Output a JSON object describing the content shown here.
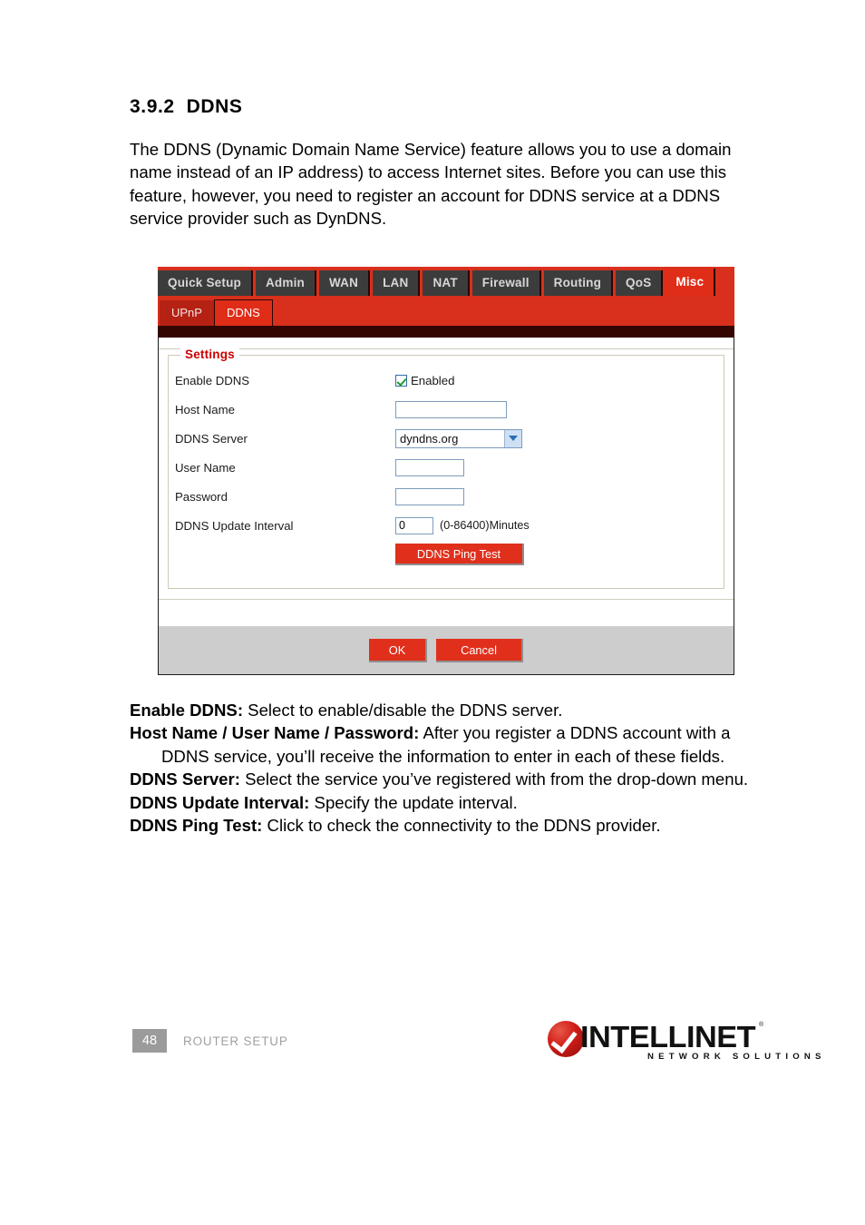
{
  "document": {
    "section_number": "3.9.2",
    "section_title": "DDNS",
    "heading": "3.9.2  DDNS",
    "intro": "The DDNS (Dynamic Domain Name Service) feature allows you to use a domain name instead of an IP address) to access Internet sites. Before you can use this feature, however, you need to register an account for DDNS service at a DDNS service provider such as DynDNS."
  },
  "screenshot": {
    "main_tabs": [
      {
        "label": "Quick Setup",
        "active": false
      },
      {
        "label": "Admin",
        "active": false
      },
      {
        "label": "WAN",
        "active": false
      },
      {
        "label": "LAN",
        "active": false
      },
      {
        "label": "NAT",
        "active": false
      },
      {
        "label": "Firewall",
        "active": false
      },
      {
        "label": "Routing",
        "active": false
      },
      {
        "label": "QoS",
        "active": false
      },
      {
        "label": "Misc",
        "active": true
      }
    ],
    "sub_tabs": [
      {
        "label": "UPnP",
        "active": false
      },
      {
        "label": "DDNS",
        "active": true
      }
    ],
    "fieldset_legend": "Settings",
    "fields": {
      "enable_ddns": {
        "label": "Enable DDNS",
        "checkbox_label": "Enabled",
        "checked": true
      },
      "host_name": {
        "label": "Host Name",
        "value": ""
      },
      "ddns_server": {
        "label": "DDNS Server",
        "value": "dyndns.org",
        "options": [
          "dyndns.org"
        ]
      },
      "user_name": {
        "label": "User Name",
        "value": ""
      },
      "password": {
        "label": "Password",
        "value": ""
      },
      "update_interval": {
        "label": "DDNS Update Interval",
        "value": "0",
        "hint": "(0-86400)Minutes"
      }
    },
    "buttons": {
      "ping_test": "DDNS Ping Test",
      "ok": "OK",
      "cancel": "Cancel"
    },
    "colors": {
      "accent_red": "#e0301c",
      "tab_dark": "#3c3c3c",
      "band_dark": "#340602",
      "footer_gray": "#cdcdcd",
      "legend_red": "#cc0000"
    }
  },
  "definitions": [
    {
      "term": "Enable DDNS:",
      "text": " Select to enable/disable the DDNS server."
    },
    {
      "term": "Host Name / User Name / Password:",
      "text": " After you register a DDNS account with a DDNS service, you’ll receive the information to enter in each of these fields."
    },
    {
      "term": "DDNS Server:",
      "text": " Select the service you’ve registered with from the drop-down menu."
    },
    {
      "term": "DDNS Update Interval:",
      "text": " Specify the update interval."
    },
    {
      "term": "DDNS Ping Test:",
      "text": " Click to check the connectivity to the DDNS provider."
    }
  ],
  "footer": {
    "page_number": "48",
    "label": "ROUTER SETUP",
    "logo": {
      "wordmark": "INTELLINET",
      "tagline": "NETWORK SOLUTIONS",
      "registered_mark": "®"
    }
  }
}
